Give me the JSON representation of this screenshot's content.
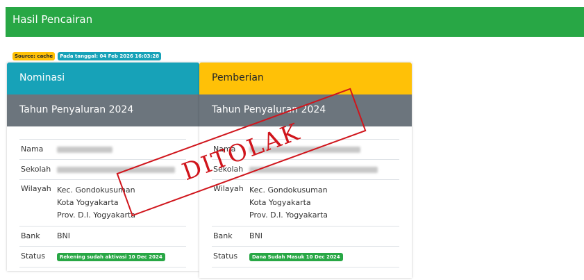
{
  "header": {
    "title": "Hasil Pencairan",
    "bg": "#28a745"
  },
  "badges": {
    "source": "Source: cache",
    "date": "Pada tanggal: 04 Feb 2026 16:03:28"
  },
  "nominasi": {
    "title": "Nominasi",
    "subtitle": "Tahun Penyaluran 2024",
    "labels": {
      "nama": "Nama",
      "sekolah": "Sekolah",
      "wilayah": "Wilayah",
      "bank": "Bank",
      "status": "Status"
    },
    "wilayah": [
      "Kec. Gondokusuman",
      "Kota Yogyakarta",
      "Prov. D.I. Yogyakarta"
    ],
    "bank": "BNI",
    "status": "Rekening sudah aktivasi 10 Dec 2024"
  },
  "pemberian": {
    "title": "Pemberian",
    "subtitle": "Tahun Penyaluran 2024",
    "labels": {
      "nama": "Nama",
      "sekolah": "Sekolah",
      "wilayah": "Wilayah",
      "bank": "Bank",
      "status": "Status"
    },
    "wilayah": [
      "Kec. Gondokusuman",
      "Kota Yogyakarta",
      "Prov. D.I. Yogyakarta"
    ],
    "bank": "BNI",
    "status": "Dana Sudah Masuk 10 Dec 2024"
  },
  "stamp": {
    "text": "DITOLAK",
    "color": "#d0151c"
  },
  "colors": {
    "nominasi": "#17a2b8",
    "pemberian": "#ffc107",
    "subheader": "#6c757d",
    "success": "#28a745"
  }
}
